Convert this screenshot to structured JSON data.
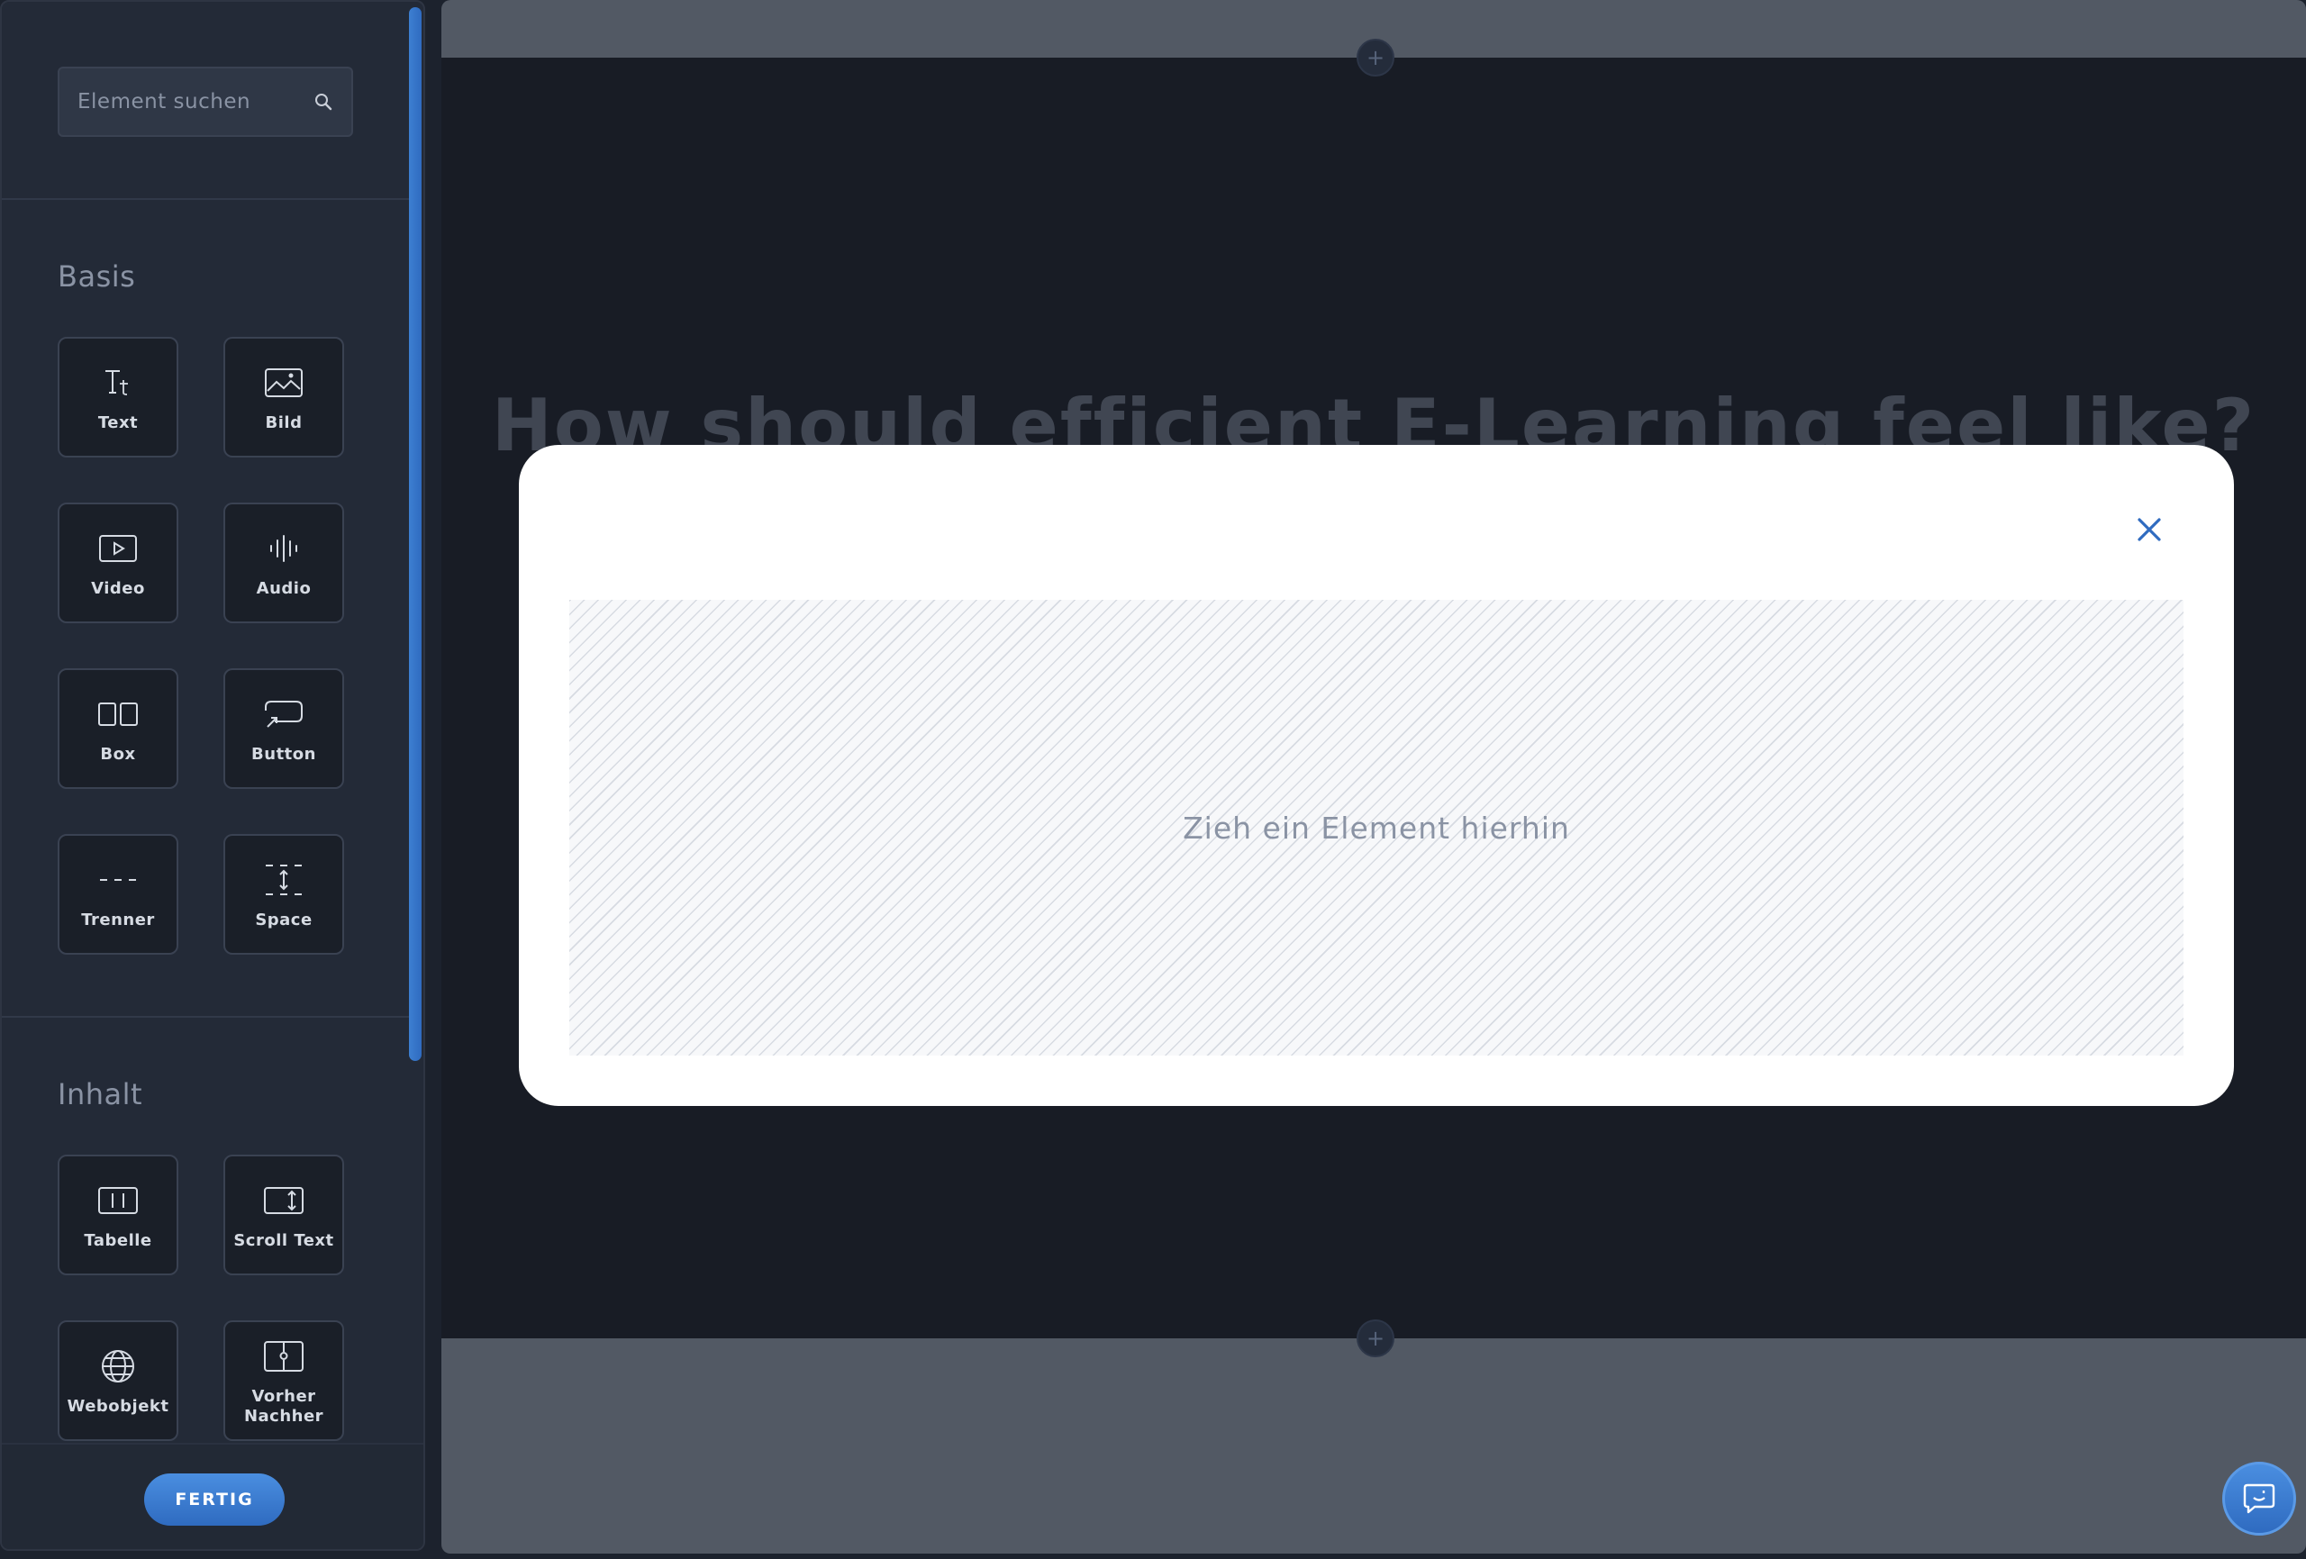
{
  "sidebar": {
    "search": {
      "placeholder": "Element suchen"
    },
    "sections": [
      {
        "heading": "Basis",
        "items": [
          {
            "label": "Text",
            "icon": "text-icon"
          },
          {
            "label": "Bild",
            "icon": "image-icon"
          },
          {
            "label": "Video",
            "icon": "video-icon"
          },
          {
            "label": "Audio",
            "icon": "audio-icon"
          },
          {
            "label": "Box",
            "icon": "box-icon"
          },
          {
            "label": "Button",
            "icon": "button-icon"
          },
          {
            "label": "Trenner",
            "icon": "divider-icon"
          },
          {
            "label": "Space",
            "icon": "space-icon"
          }
        ]
      },
      {
        "heading": "Inhalt",
        "items": [
          {
            "label": "Tabelle",
            "icon": "table-icon"
          },
          {
            "label": "Scroll Text",
            "icon": "scroll-text-icon"
          },
          {
            "label": "Webobjekt",
            "icon": "globe-icon"
          },
          {
            "label": "Vorher Nachher",
            "icon": "before-after-icon"
          }
        ]
      }
    ],
    "done_label": "FERTIG"
  },
  "canvas": {
    "section_heading": "How should efficient E-Learning feel like?",
    "add_section_icon": "plus-icon"
  },
  "modal": {
    "dropzone_label": "Zieh ein Element hierhin",
    "close_icon": "close-icon"
  },
  "colors": {
    "accent": "#3d7fd1",
    "sidebar_bg": "#232a37",
    "canvas_dark": "#181c25",
    "canvas_gray": "#525964",
    "tile_bg": "#1a1f28"
  },
  "chat": {
    "icon": "chat-icon"
  }
}
